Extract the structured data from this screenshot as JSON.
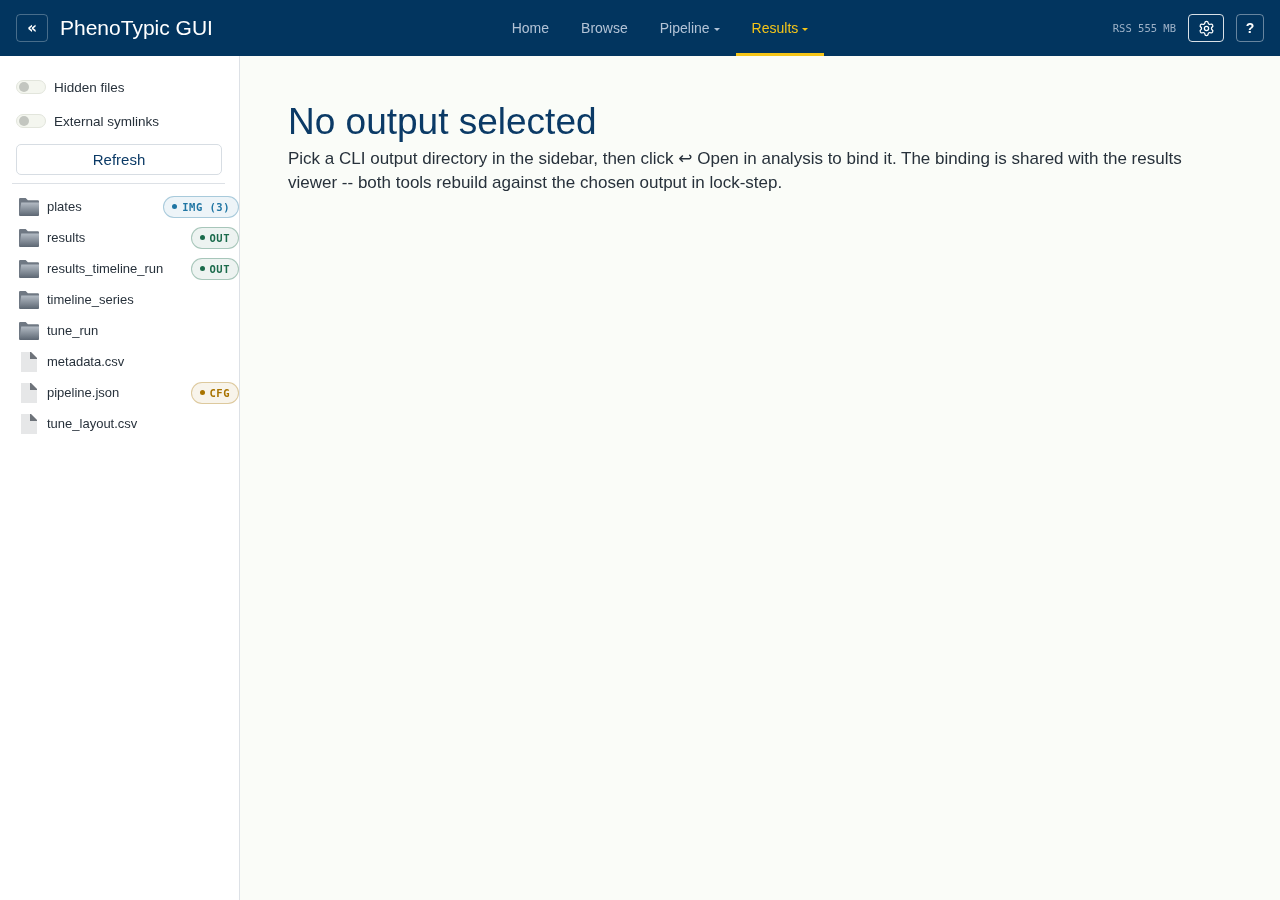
{
  "header": {
    "collapse_glyph": "«",
    "title": "PhenoTypic GUI",
    "nav": [
      {
        "label": "Home",
        "selected": false,
        "dropdown": false
      },
      {
        "label": "Browse",
        "selected": false,
        "dropdown": false
      },
      {
        "label": "Pipeline",
        "selected": false,
        "dropdown": true
      },
      {
        "label": "Results",
        "selected": true,
        "dropdown": true
      }
    ],
    "memory": "RSS 555 MB",
    "help_glyph": "?"
  },
  "sidebar": {
    "toggles": [
      {
        "label": "Hidden files",
        "on": false
      },
      {
        "label": "External symlinks",
        "on": false
      }
    ],
    "refresh_button": "Refresh",
    "entries": [
      {
        "kind": "folder",
        "name": "plates",
        "badge": {
          "label": "IMG (3)",
          "color": "#1f75a3"
        }
      },
      {
        "kind": "folder",
        "name": "results",
        "badge": {
          "label": "OUT",
          "color": "#1b6b4c"
        }
      },
      {
        "kind": "folder",
        "name": "results_timeline_run",
        "badge": {
          "label": "OUT",
          "color": "#1b6b4c"
        }
      },
      {
        "kind": "folder",
        "name": "timeline_series"
      },
      {
        "kind": "folder",
        "name": "tune_run"
      },
      {
        "kind": "file",
        "name": "metadata.csv"
      },
      {
        "kind": "file",
        "name": "pipeline.json",
        "badge": {
          "label": "CFG",
          "color": "#a87300"
        }
      },
      {
        "kind": "file",
        "name": "tune_layout.csv"
      }
    ]
  },
  "main": {
    "heading": "No output selected",
    "message": "Pick a CLI output directory in the sidebar, then click ↩ Open in analysis to bind it. The binding is shared with the results viewer -- both tools rebuild against the chosen output in lock-step."
  }
}
